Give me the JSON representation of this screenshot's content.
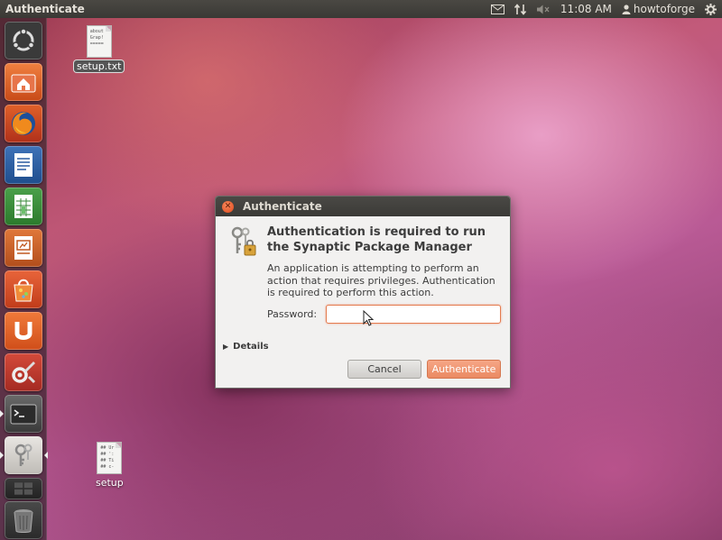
{
  "top_panel": {
    "title": "Authenticate",
    "time": "11:08 AM",
    "user": "howtoforge",
    "icons": [
      "mail-icon",
      "network-icon",
      "volume-muted-icon",
      "user-icon",
      "gear-icon"
    ]
  },
  "launcher": {
    "items": [
      {
        "name": "dash-home-icon",
        "running": false
      },
      {
        "name": "home-folder-icon",
        "running": false
      },
      {
        "name": "firefox-icon",
        "running": false
      },
      {
        "name": "libreoffice-writer-icon",
        "running": false
      },
      {
        "name": "libreoffice-calc-icon",
        "running": false
      },
      {
        "name": "libreoffice-impress-icon",
        "running": false
      },
      {
        "name": "software-center-icon",
        "running": false
      },
      {
        "name": "ubuntu-one-icon",
        "running": false
      },
      {
        "name": "system-settings-icon",
        "running": false
      },
      {
        "name": "terminal-icon",
        "running": true
      },
      {
        "name": "authentication-keys-icon",
        "running": true
      },
      {
        "name": "workspace-switcher-icon",
        "running": false
      },
      {
        "name": "trash-icon",
        "running": false
      }
    ]
  },
  "desktop": {
    "icons": [
      {
        "label": "setup.txt",
        "selected": true,
        "preview": [
          "about",
          "Grap!",
          "====="
        ]
      },
      {
        "label": "setup",
        "selected": false,
        "preview": [
          "## Ur",
          "## ':",
          "## Ti",
          "## c-"
        ]
      }
    ]
  },
  "dialog": {
    "title": "Authenticate",
    "heading": "Authentication is required to run the Synaptic Package Manager",
    "description": "An application is attempting to perform an action that requires privileges. Authentication is required to perform this action.",
    "password_label": "Password:",
    "password_value": "",
    "details_label": "Details",
    "cancel_label": "Cancel",
    "authenticate_label": "Authenticate"
  },
  "colors": {
    "accent": "#E9541F",
    "panel": "#3C3B37",
    "dialog_bg": "#F2F1F0"
  }
}
